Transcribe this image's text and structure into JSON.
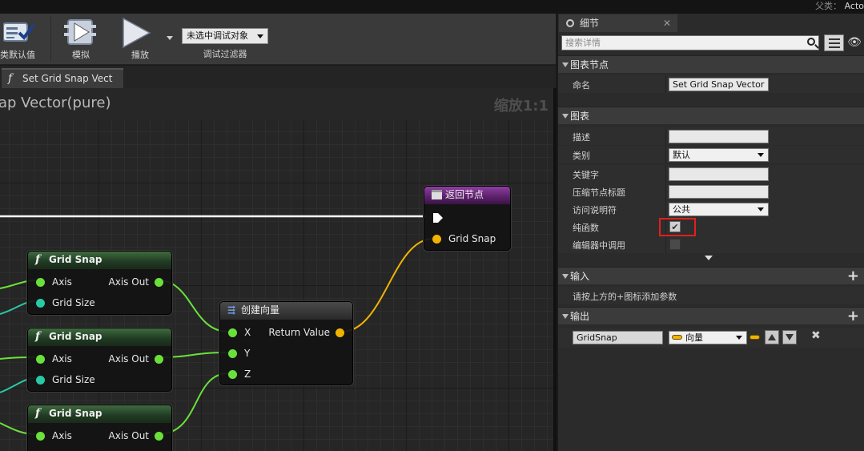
{
  "top": {
    "parent_label": "父类：",
    "parent_value": "Acto"
  },
  "toolbar": {
    "class_defaults_label": "类默认值",
    "simulate_label": "模拟",
    "play_label": "播放",
    "debug_object_value": "未选中调试对象",
    "debug_filter_label": "调试过滤器"
  },
  "tabs": {
    "graph_tab_label": "Set Grid Snap Vect"
  },
  "graph": {
    "title": "ap Vector(pure)",
    "zoom": "缩放1:1",
    "return_node": {
      "title": "返回节点",
      "pin": "Grid Snap"
    },
    "make_vector": {
      "title": "创建向量",
      "pins": [
        "X",
        "Y",
        "Z"
      ],
      "output": "Return Value"
    },
    "grid_snap_nodes": [
      {
        "title": "Grid Snap",
        "in1": "Axis",
        "in2": "Grid Size",
        "out": "Axis Out"
      },
      {
        "title": "Grid Snap",
        "in1": "Axis",
        "in2": "Grid Size",
        "out": "Axis Out"
      },
      {
        "title": "Grid Snap",
        "in1": "Axis",
        "out": "Axis Out"
      }
    ],
    "colors": {
      "float_pin": "#6ae13a",
      "int_pin": "#29c9a6",
      "vector_pin": "#f0b400",
      "exec_wire": "#ffffff"
    }
  },
  "details": {
    "tab_label": "细节",
    "search_placeholder": "搜索详情",
    "graph_node_section": "图表节点",
    "name_label": "命名",
    "name_value": "Set Grid Snap Vector",
    "graph_section": "图表",
    "desc_label": "描述",
    "desc_value": "",
    "category_label": "类别",
    "category_value": "默认",
    "keywords_label": "关键字",
    "keywords_value": "",
    "compact_title_label": "压缩节点标题",
    "compact_title_value": "",
    "access_label": "访问说明符",
    "access_value": "公共",
    "pure_label": "纯函数",
    "pure_checked": true,
    "call_in_editor_label": "编辑器中调用",
    "call_in_editor_checked": false,
    "inputs_section": "输入",
    "inputs_hint": "请按上方的+图标添加参数",
    "outputs_section": "输出",
    "output_name": "GridSnap",
    "output_type": "向量",
    "highlight_color": "#e0201c"
  }
}
